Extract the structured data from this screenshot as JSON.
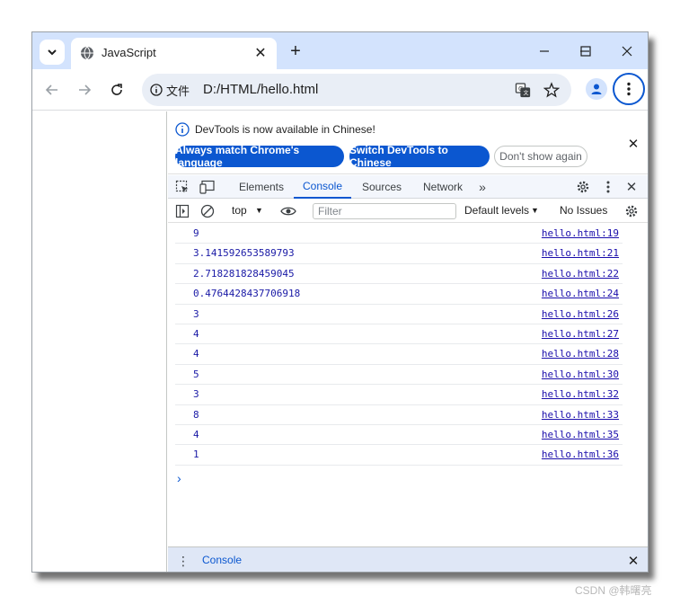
{
  "browser": {
    "tab_title": "JavaScript",
    "address_site_label": "文件",
    "address_url": "D:/HTML/hello.html"
  },
  "devtools": {
    "infobar": {
      "message": "DevTools is now available in Chinese!",
      "btn_match": "Always match Chrome's language",
      "btn_switch": "Switch DevTools to Chinese",
      "btn_dismiss": "Don't show again"
    },
    "tabs": [
      "Elements",
      "Console",
      "Sources",
      "Network"
    ],
    "active_tab": "Console",
    "console_toolbar": {
      "context": "top",
      "filter_placeholder": "Filter",
      "levels": "Default levels",
      "issues": "No Issues"
    },
    "logs": [
      {
        "value": "9",
        "source": "hello.html:19"
      },
      {
        "value": "3.141592653589793",
        "source": "hello.html:21"
      },
      {
        "value": "2.718281828459045",
        "source": "hello.html:22"
      },
      {
        "value": "0.4764428437706918",
        "source": "hello.html:24"
      },
      {
        "value": "3",
        "source": "hello.html:26"
      },
      {
        "value": "4",
        "source": "hello.html:27"
      },
      {
        "value": "4",
        "source": "hello.html:28"
      },
      {
        "value": "5",
        "source": "hello.html:30"
      },
      {
        "value": "3",
        "source": "hello.html:32"
      },
      {
        "value": "8",
        "source": "hello.html:33"
      },
      {
        "value": "4",
        "source": "hello.html:35"
      },
      {
        "value": "1",
        "source": "hello.html:36"
      }
    ],
    "drawer_tab": "Console"
  },
  "watermark": "CSDN @韩曙亮"
}
